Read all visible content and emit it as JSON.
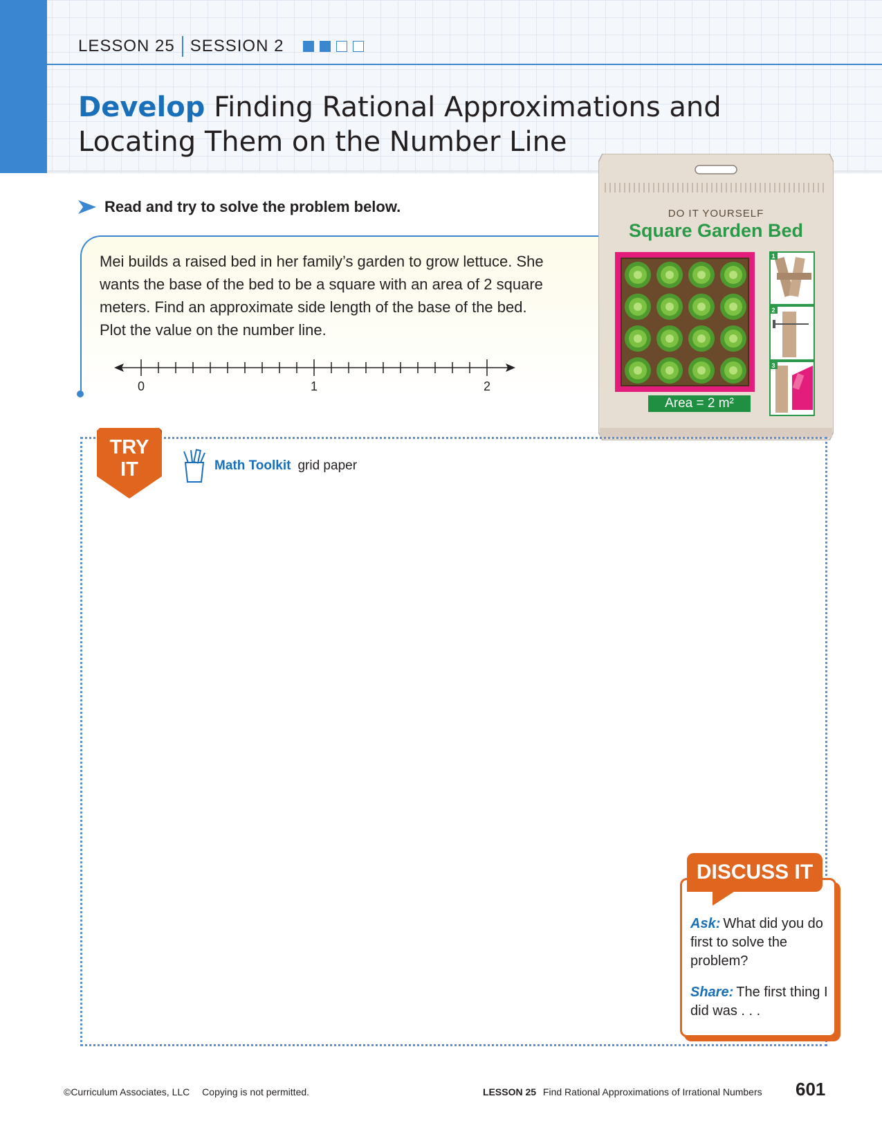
{
  "header": {
    "lesson": "LESSON 25",
    "session": "SESSION 2",
    "session_progress": {
      "completed": 2,
      "total": 4
    },
    "title_highlight": "Develop",
    "title_rest": " Finding Rational Approximations and Locating Them on the Number Line"
  },
  "instruction": "Read and try to solve the problem below.",
  "problem": {
    "text": "Mei builds a raised bed in her family’s garden to grow lettuce. She wants the base of the bed to be a square with an area of 2 square meters. Find an approximate side length of the base of the bed. Plot the value on the number line.",
    "number_line": {
      "labels": [
        "0",
        "1",
        "2"
      ],
      "min": 0,
      "max": 2,
      "subdivisions_per_unit": 10
    }
  },
  "package": {
    "top_label": "DO IT YOURSELF",
    "title": "Square Garden Bed",
    "area_label": "Area = 2 m²",
    "step_numbers": [
      "1",
      "2",
      "3"
    ]
  },
  "try_it": {
    "badge_line1": "TRY",
    "badge_line2": "IT",
    "toolkit_label": "Math Toolkit",
    "toolkit_item": "grid paper"
  },
  "discuss": {
    "title": "DISCUSS IT",
    "ask_label": "Ask:",
    "ask_text": "What did you do first to solve the problem?",
    "share_label": "Share:",
    "share_text": "The first thing I did was . . ."
  },
  "footer": {
    "copyright": "©Curriculum Associates, LLC",
    "notice": "Copying is not permitted.",
    "lesson": "LESSON 25",
    "lesson_title": "Find Rational Approximations of Irrational Numbers",
    "page_number": "601"
  },
  "colors": {
    "accent_blue": "#3a86cf",
    "title_blue": "#1a6fb9",
    "orange": "#e0661f",
    "package_green": "#2a9a48",
    "package_pink": "#e21d7c"
  }
}
